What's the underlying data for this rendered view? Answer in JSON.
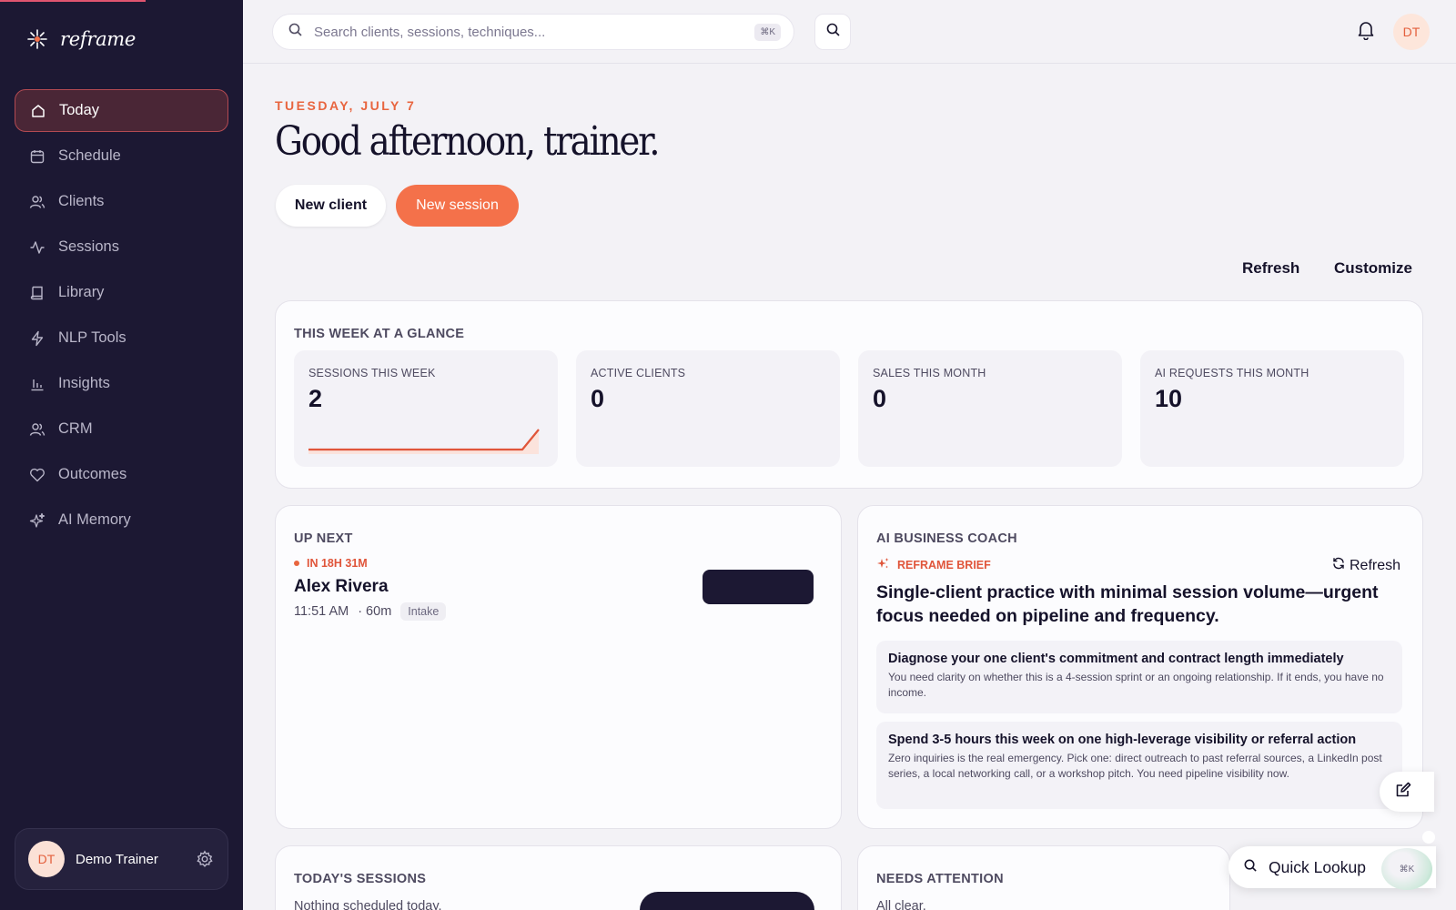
{
  "app": {
    "name": "reframe"
  },
  "colors": {
    "accent": "#f4714a",
    "sidebar": "#1c1833",
    "active_border": "#b34a52"
  },
  "sidebar": {
    "items": [
      {
        "label": "Today",
        "icon": "home-icon"
      },
      {
        "label": "Schedule",
        "icon": "calendar-icon"
      },
      {
        "label": "Clients",
        "icon": "users-icon"
      },
      {
        "label": "Sessions",
        "icon": "activity-icon"
      },
      {
        "label": "Library",
        "icon": "book-icon"
      },
      {
        "label": "NLP Tools",
        "icon": "bolt-icon"
      },
      {
        "label": "Insights",
        "icon": "bar-chart-icon"
      },
      {
        "label": "CRM",
        "icon": "users-icon"
      },
      {
        "label": "Outcomes",
        "icon": "heart-icon"
      },
      {
        "label": "AI Memory",
        "icon": "sparkles-icon"
      }
    ],
    "user": {
      "initials": "DT",
      "name": "Demo Trainer"
    }
  },
  "topbar": {
    "search_placeholder": "Search clients, sessions, techniques...",
    "shortcut": "⌘K",
    "user_initials": "DT"
  },
  "header": {
    "date": "TUESDAY, JULY 7",
    "greeting": "Good afternoon, trainer.",
    "new_client": "New client",
    "new_session": "New session",
    "refresh": "Refresh",
    "customize": "Customize"
  },
  "glance": {
    "title": "THIS WEEK AT A GLANCE",
    "stats": [
      {
        "label": "SESSIONS THIS WEEK",
        "value": "2"
      },
      {
        "label": "ACTIVE CLIENTS",
        "value": "0"
      },
      {
        "label": "SALES THIS MONTH",
        "value": "0"
      },
      {
        "label": "AI REQUESTS THIS MONTH",
        "value": "10"
      }
    ]
  },
  "up_next": {
    "title": "UP NEXT",
    "countdown": "IN 18H 31M",
    "client": "Alex Rivera",
    "time": "11:51 AM",
    "duration": "· 60m",
    "type": "Intake"
  },
  "coach": {
    "title": "AI BUSINESS COACH",
    "brief_label": "REFRAME BRIEF",
    "refresh": "Refresh",
    "headline": "Single-client practice with minimal session volume—urgent focus needed on pipeline and frequency.",
    "recommendations": [
      {
        "title": "Diagnose your one client's commitment and contract length immediately",
        "body": "You need clarity on whether this is a 4-session sprint or an ongoing relationship. If it ends, you have no income."
      },
      {
        "title": "Spend 3-5 hours this week on one high-leverage visibility or referral action",
        "body": "Zero inquiries is the real emergency. Pick one: direct outreach to past referral sources, a LinkedIn post series, a local networking call, or a workshop pitch. You need pipeline visibility now."
      }
    ]
  },
  "todays_sessions": {
    "title": "TODAY'S SESSIONS",
    "empty": "Nothing scheduled today."
  },
  "needs_attention": {
    "title": "NEEDS ATTENTION",
    "empty": "All clear."
  },
  "quick_lookup": {
    "label": "Quick Lookup",
    "shortcut": "⌘K"
  }
}
